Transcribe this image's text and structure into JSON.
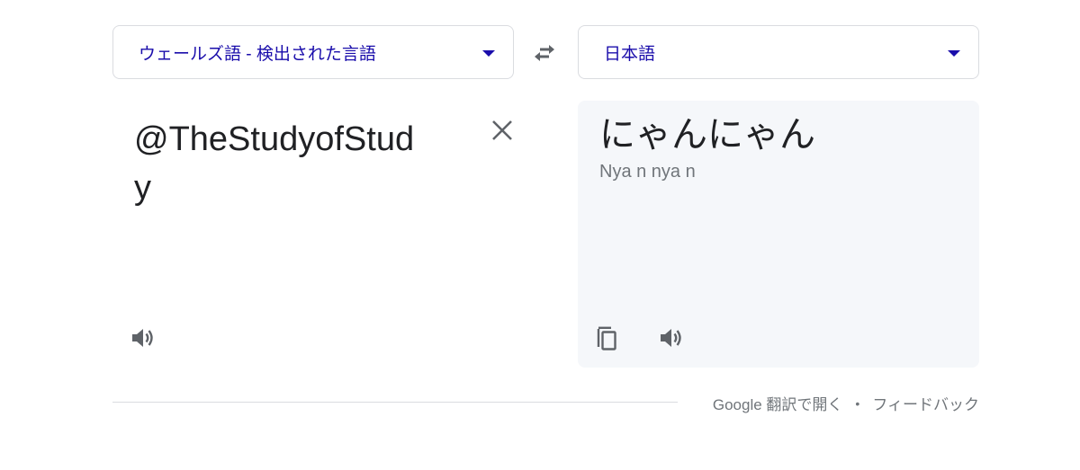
{
  "source_language": {
    "label": "ウェールズ語 - 検出された言語"
  },
  "target_language": {
    "label": "日本語"
  },
  "source": {
    "text": "@TheStudyofStudy"
  },
  "target": {
    "text": "にゃんにゃん",
    "romanization": "Nya n nya n"
  },
  "footer": {
    "open_in_translate": "Google 翻訳で開く",
    "separator": "•",
    "feedback": "フィードバック"
  },
  "icons": {
    "swap": "swap-arrows-icon",
    "clear": "close-icon",
    "speaker": "speaker-icon",
    "copy": "copy-icon",
    "dropdown": "caret-down-icon"
  },
  "colors": {
    "accent": "#1a0dab",
    "icon": "#5f6368",
    "target_bg": "#f5f7fa",
    "muted_text": "#70757a"
  }
}
